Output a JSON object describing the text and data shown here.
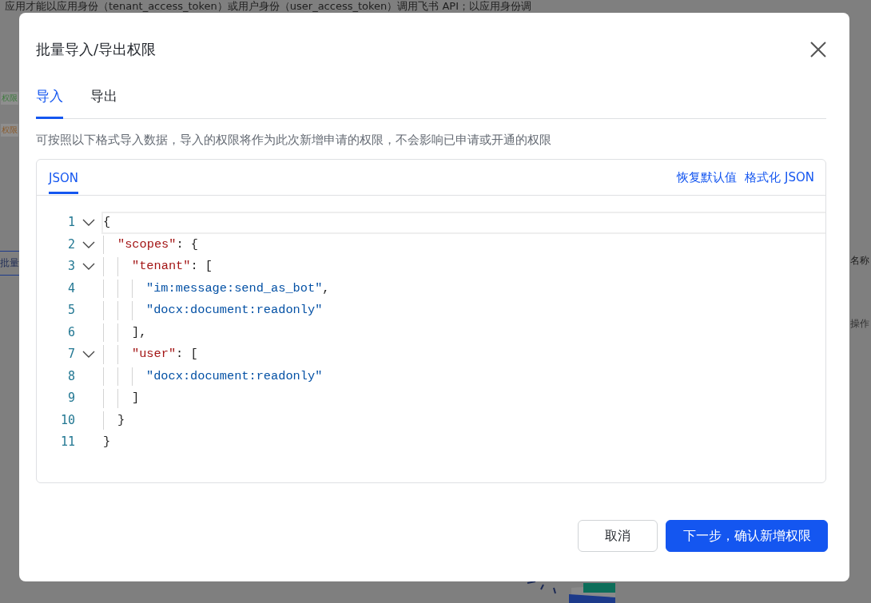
{
  "background": {
    "intro_text": "应用才能以应用身份（tenant_access_token）或用户身份（user_access_token）调用飞书 API；以应用身份调",
    "left_tags": [
      {
        "label": "权限",
        "color": "#3c7a3c"
      },
      {
        "label": "权限",
        "color": "#8a5a2a"
      }
    ],
    "left_tab": "批量",
    "right_header": "名称",
    "right_action": "操作"
  },
  "dialog": {
    "title": "批量导入/导出权限",
    "tabs": [
      {
        "label": "导入",
        "selected": true
      },
      {
        "label": "导出",
        "selected": false
      }
    ],
    "description": "可按照以下格式导入数据，导入的权限将作为此次新增申请的权限，不会影响已申请或开通的权限",
    "editor": {
      "tabs": [
        {
          "label": "JSON",
          "selected": true
        }
      ],
      "actions": [
        "恢复默认值",
        "格式化 JSON"
      ],
      "lines": [
        {
          "number": "1",
          "current": true,
          "tokens": [
            {
              "kind": "punct",
              "text": "{"
            }
          ],
          "children": [
            {
              "number": "2",
              "current": false,
              "tokens": [
                {
                  "kind": "key",
                  "text": "\"scopes\""
                },
                {
                  "kind": "punct",
                  "text": ": {"
                }
              ],
              "children": [
                {
                  "number": "3",
                  "current": false,
                  "tokens": [
                    {
                      "kind": "key",
                      "text": "\"tenant\""
                    },
                    {
                      "kind": "punct",
                      "text": ": ["
                    }
                  ],
                  "children": [
                    {
                      "number": "4",
                      "current": false,
                      "tokens": [
                        {
                          "kind": "string",
                          "text": "\"im:message:send_as_bot\""
                        },
                        {
                          "kind": "punct",
                          "text": ","
                        }
                      ]
                    },
                    {
                      "number": "5",
                      "current": false,
                      "tokens": [
                        {
                          "kind": "string",
                          "text": "\"docx:document:readonly\""
                        }
                      ]
                    }
                  ],
                  "close": {
                    "number": "6",
                    "current": false,
                    "tokens": [
                      {
                        "kind": "punct",
                        "text": "],"
                      }
                    ]
                  }
                },
                {
                  "number": "7",
                  "current": false,
                  "tokens": [
                    {
                      "kind": "key",
                      "text": "\"user\""
                    },
                    {
                      "kind": "punct",
                      "text": ": ["
                    }
                  ],
                  "children": [
                    {
                      "number": "8",
                      "current": false,
                      "tokens": [
                        {
                          "kind": "string",
                          "text": "\"docx:document:readonly\""
                        }
                      ]
                    }
                  ],
                  "close": {
                    "number": "9",
                    "current": false,
                    "tokens": [
                      {
                        "kind": "punct",
                        "text": "]"
                      }
                    ]
                  }
                }
              ],
              "close": {
                "number": "10",
                "current": false,
                "tokens": [
                  {
                    "kind": "punct",
                    "text": "}"
                  }
                ]
              }
            }
          ],
          "close": {
            "number": "11",
            "current": false,
            "tokens": [
              {
                "kind": "punct",
                "text": "}"
              }
            ]
          }
        }
      ]
    },
    "buttons": [
      {
        "label": "取消",
        "kind": "secondary"
      },
      {
        "label": "下一步，确认新增权限",
        "kind": "primary"
      }
    ]
  }
}
